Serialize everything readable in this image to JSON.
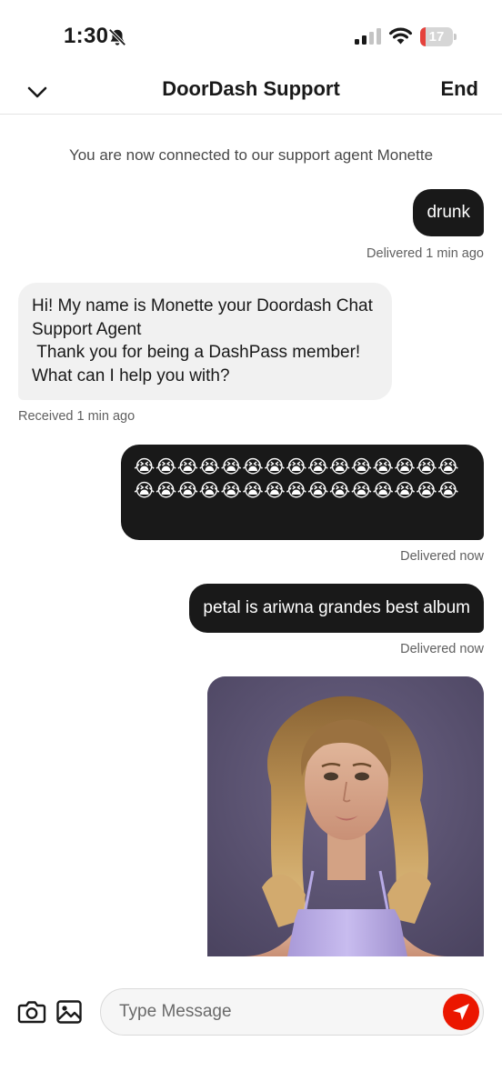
{
  "status_bar": {
    "time": "1:30",
    "battery_level": "17",
    "battery_fraction": 0.17,
    "icons": [
      "bell-slash-icon",
      "signal-icon",
      "wifi-icon",
      "battery-icon"
    ]
  },
  "header": {
    "title": "DoorDash Support",
    "end_label": "End",
    "back_icon": "chevron-down-icon"
  },
  "chat": {
    "system_message": "You are now connected to our support agent Monette",
    "messages": [
      {
        "direction": "outgoing",
        "text": "drunk",
        "status": "Delivered 1 min ago"
      },
      {
        "direction": "incoming",
        "text": "Hi! My name is Monette your Doordash Chat Support Agent\n Thank you for being a DashPass member!\nWhat can I help you with?",
        "status": "Received 1 min ago"
      },
      {
        "direction": "outgoing",
        "text": "😭😭😭😭😭😭😭😭😭😭😭😭😭😭😭😭😭😭😭😭😭😭😭😭😭😭😭😭😭😭",
        "status": "Delivered now"
      },
      {
        "direction": "outgoing",
        "text": "petal is ariwna grandes best album",
        "status": "Delivered now"
      },
      {
        "direction": "outgoing",
        "type": "image"
      }
    ]
  },
  "composer": {
    "placeholder": "Type Message",
    "value": "",
    "camera_icon": "camera-icon",
    "gallery_icon": "image-icon",
    "send_icon": "send-icon"
  },
  "colors": {
    "outgoing_bubble": "#191919",
    "incoming_bubble": "#f1f1f1",
    "send_button": "#eb1700",
    "battery_low": "#e5423c"
  }
}
